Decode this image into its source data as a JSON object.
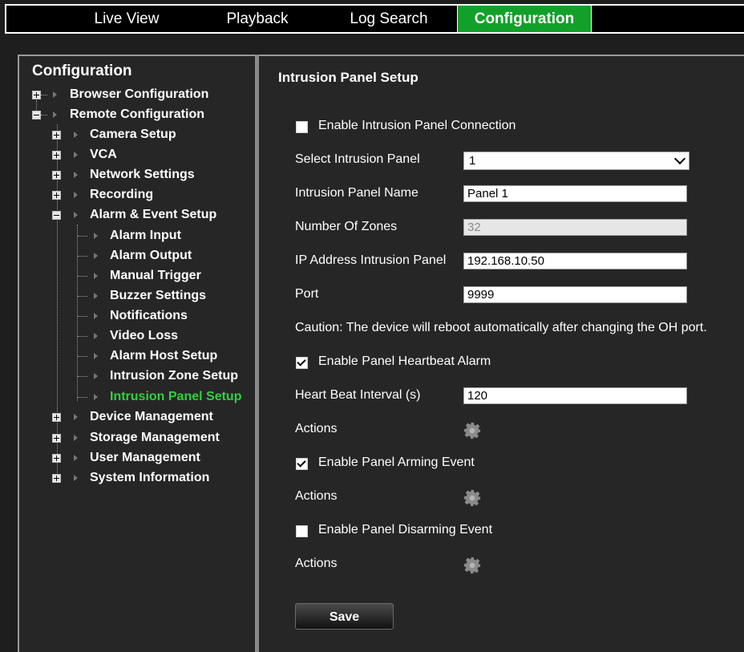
{
  "nav": {
    "tabs": [
      {
        "label": "Live View"
      },
      {
        "label": "Playback"
      },
      {
        "label": "Log Search"
      },
      {
        "label": "Configuration"
      }
    ],
    "active_color": "#12a02a"
  },
  "tree": {
    "title": "Configuration",
    "items": [
      {
        "label": "Browser Configuration"
      },
      {
        "label": "Remote Configuration"
      },
      {
        "label": "Camera Setup"
      },
      {
        "label": "VCA"
      },
      {
        "label": "Network Settings"
      },
      {
        "label": "Recording"
      },
      {
        "label": "Alarm & Event Setup"
      },
      {
        "label": "Alarm Input"
      },
      {
        "label": "Alarm Output"
      },
      {
        "label": "Manual Trigger"
      },
      {
        "label": "Buzzer Settings"
      },
      {
        "label": "Notifications"
      },
      {
        "label": "Video Loss"
      },
      {
        "label": "Alarm Host Setup"
      },
      {
        "label": "Intrusion Zone Setup"
      },
      {
        "label": "Intrusion Panel Setup"
      },
      {
        "label": "Device Management"
      },
      {
        "label": "Storage Management"
      },
      {
        "label": "User Management"
      },
      {
        "label": "System Information"
      }
    ],
    "active_color": "#2fd13f"
  },
  "form": {
    "title": "Intrusion Panel Setup",
    "enable_connection": {
      "label": "Enable Intrusion Panel Connection",
      "checked": false
    },
    "select_panel": {
      "label": "Select Intrusion Panel",
      "value": "1"
    },
    "panel_name": {
      "label": "Intrusion Panel Name",
      "value": "Panel 1"
    },
    "zones": {
      "label": "Number Of Zones",
      "value": "32"
    },
    "ip_address": {
      "label": "IP Address Intrusion Panel",
      "value": "192.168.10.50"
    },
    "port": {
      "label": "Port",
      "value": "9999"
    },
    "caution": "Caution: The device will reboot automatically after changing the OH port.",
    "heartbeat_alarm": {
      "label": "Enable Panel Heartbeat Alarm",
      "checked": true
    },
    "heartbeat_interval": {
      "label": "Heart Beat Interval (s)",
      "value": "120"
    },
    "actions_label": "Actions",
    "arming_event": {
      "label": "Enable Panel Arming Event",
      "checked": true
    },
    "disarming_event": {
      "label": "Enable Panel Disarming Event",
      "checked": false
    },
    "save_label": "Save"
  }
}
